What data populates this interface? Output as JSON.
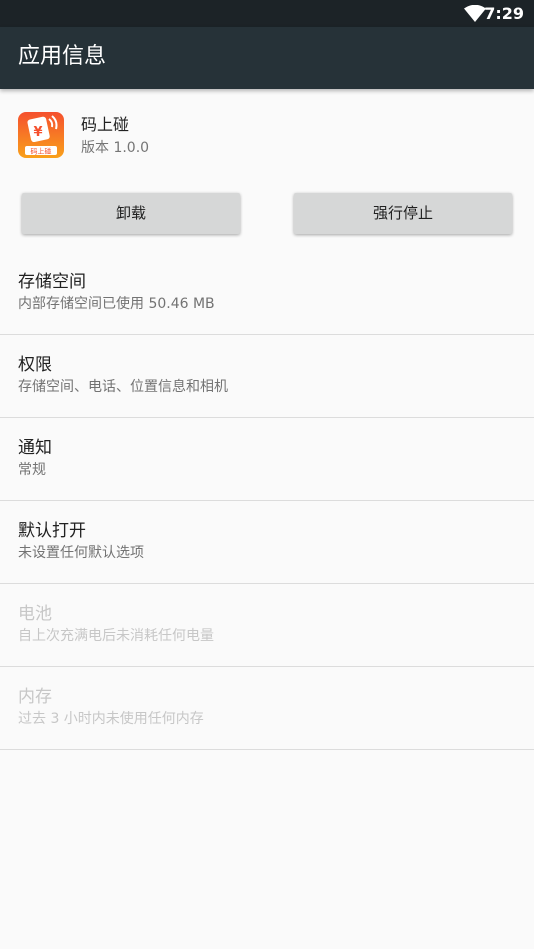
{
  "status_bar": {
    "time": "7:29",
    "wifi_icon": "wifi-icon"
  },
  "app_bar": {
    "title": "应用信息"
  },
  "app": {
    "name": "码上碰",
    "version": "版本 1.0.0",
    "icon": "app-icon",
    "icon_label": "码上碰",
    "colors": {
      "icon_top": "#f5502e",
      "icon_bottom": "#f9a11b"
    }
  },
  "buttons": {
    "uninstall": "卸载",
    "force_stop": "强行停止"
  },
  "items": [
    {
      "title": "存储空间",
      "summary": "内部存储空间已使用 50.46 MB",
      "enabled": true
    },
    {
      "title": "权限",
      "summary": "存储空间、电话、位置信息和相机",
      "enabled": true
    },
    {
      "title": "通知",
      "summary": "常规",
      "enabled": true
    },
    {
      "title": "默认打开",
      "summary": "未设置任何默认选项",
      "enabled": true
    },
    {
      "title": "电池",
      "summary": "自上次充满电后未消耗任何电量",
      "enabled": false
    },
    {
      "title": "内存",
      "summary": "过去 3 小时内未使用任何内存",
      "enabled": false
    }
  ],
  "colors": {
    "status_bar": "#1c2327",
    "app_bar": "#263238",
    "background": "#fafafa",
    "button": "#d6d7d7"
  }
}
